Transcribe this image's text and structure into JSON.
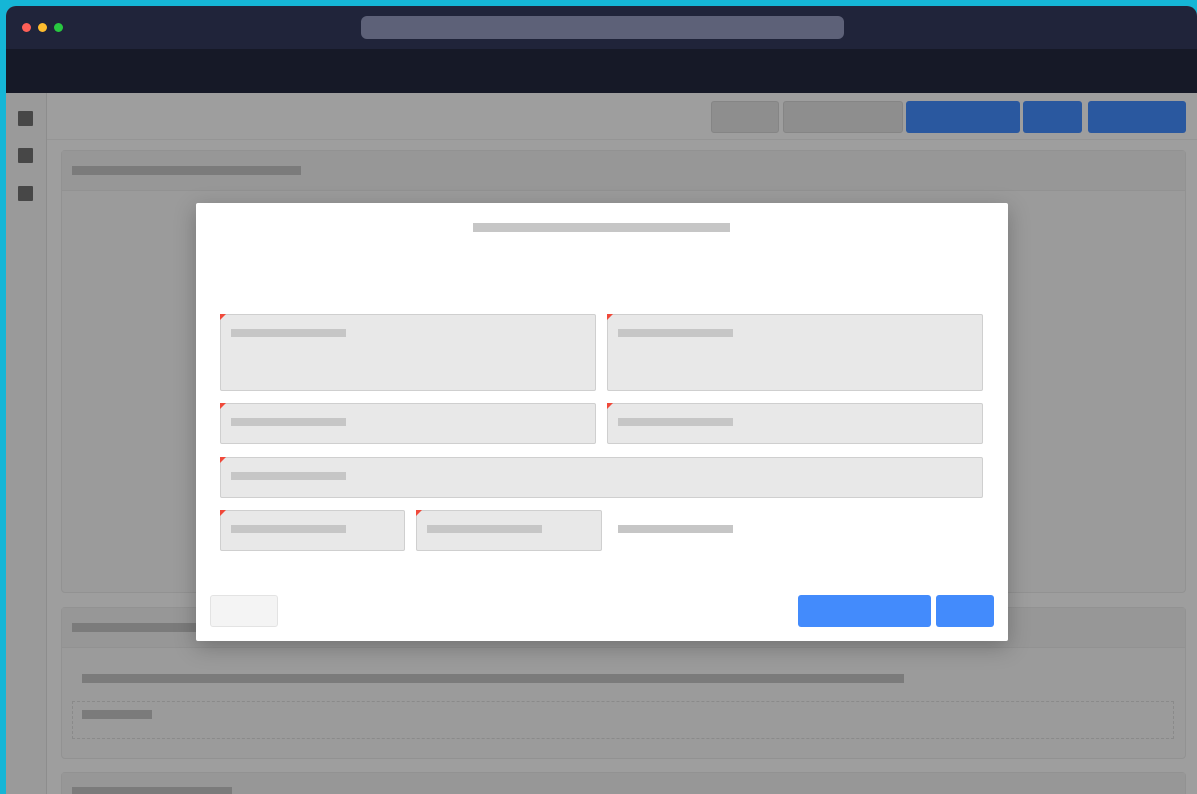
{
  "window": {
    "title_text": "",
    "url_text": "",
    "traffic_lights": [
      "close",
      "minimize",
      "maximize"
    ]
  },
  "colors": {
    "background": "#15b6d6",
    "titlebar": "#20243a",
    "appbar": "#161927",
    "toolbar_primary": "#2a589f",
    "modal_primary": "#438bfc",
    "required_marker": "#f0493a",
    "field_fill": "#e8e8e8"
  },
  "sidebar": {
    "items": [
      {
        "icon": "square-icon"
      },
      {
        "icon": "square-icon"
      },
      {
        "icon": "square-icon"
      }
    ]
  },
  "toolbar": {
    "buttons": [
      "",
      "",
      "",
      "",
      ""
    ]
  },
  "modal": {
    "title": "",
    "fields": [
      {
        "label": "",
        "required": true,
        "value": ""
      },
      {
        "label": "",
        "required": true,
        "value": ""
      },
      {
        "label": "",
        "required": true,
        "value": ""
      },
      {
        "label": "",
        "required": true,
        "value": ""
      },
      {
        "label": "",
        "required": true,
        "value": ""
      },
      {
        "label": "",
        "required": true,
        "value": ""
      },
      {
        "label": "",
        "required": true,
        "value": ""
      }
    ],
    "helper_text": "",
    "buttons": {
      "cancel_label": "",
      "primary_label": "",
      "secondary_label": ""
    }
  }
}
